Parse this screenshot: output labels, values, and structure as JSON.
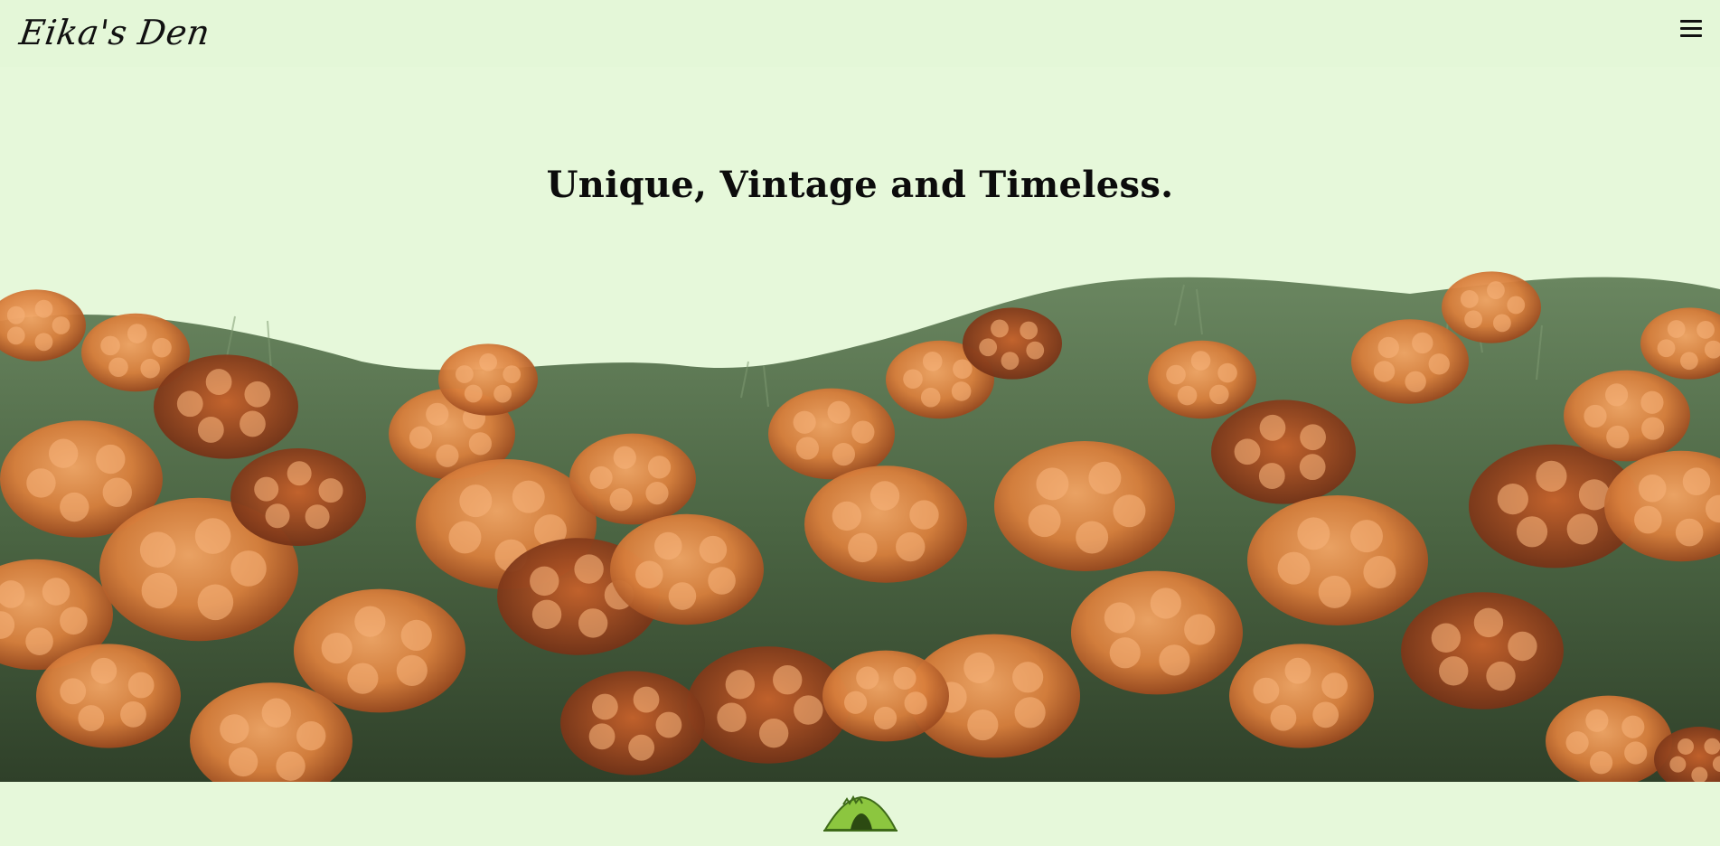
{
  "header": {
    "logo_text": "Eika's Den",
    "menu_icon": "hamburger-menu-icon"
  },
  "hero": {
    "headline": "Unique, Vintage and Timeless.",
    "image": "orange-flower-hillside-image"
  },
  "footer": {
    "icon": "green-tent-logo-icon"
  },
  "colors": {
    "background": "#e6f8da",
    "text": "#0c0c0c",
    "flower_orange": "#e38a4a",
    "flower_dark": "#a9461f",
    "grass_green": "#4f6b45"
  }
}
